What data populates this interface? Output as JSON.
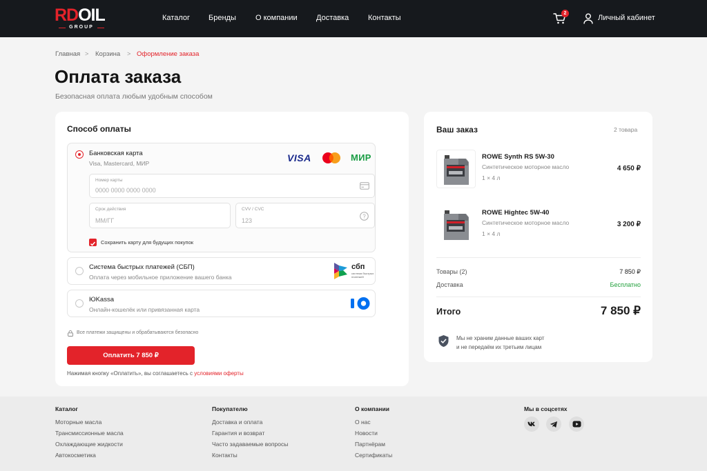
{
  "header": {
    "logo_rd": "RD",
    "logo_oil": "OIL",
    "logo_sub": "GROUP",
    "nav": [
      "Каталог",
      "Бренды",
      "О компании",
      "Доставка",
      "Контакты"
    ],
    "cart_count": "2",
    "account_label": "Личный кабинет"
  },
  "breadcrumb": {
    "items": [
      "Главная",
      "Корзина",
      "Оформление заказа"
    ],
    "separator": ">"
  },
  "page": {
    "title": "Оплата заказа",
    "subtitle": "Безопасная оплата любым удобным способом"
  },
  "payment": {
    "heading": "Способ оплаты",
    "options": [
      {
        "title": "Банковская карта",
        "desc": "Visa, Mastercard, МИР",
        "selected": true
      },
      {
        "title": "Система быстрых платежей (СБП)",
        "desc": "Оплата через мобильное приложение вашего банка",
        "selected": false
      },
      {
        "title": "ЮKassa",
        "desc": "Онлайн-кошелёк или привязанная карта",
        "selected": false
      }
    ],
    "brands": {
      "visa": "VISA",
      "mir": "МИР"
    },
    "sbp": {
      "name": "сбп",
      "tagline": "система быстрых платежей"
    },
    "fields": {
      "card_label": "Номер карты",
      "card_placeholder": "0000 0000 0000 0000",
      "expiry_label": "Срок действия",
      "expiry_placeholder": "ММ/ГГ",
      "cvv_label": "CVV / CVC",
      "cvv_placeholder": "123"
    },
    "save_card": {
      "label": "Сохранить карту для будущих покупок",
      "checked": true
    },
    "secure_note": "Все платежи защищены и обрабатываются безопасно",
    "pay_button": "Оплатить 7 850 ₽",
    "terms_prefix": "Нажимая кнопку «Оплатить», вы соглашаетесь с",
    "terms_link": "условиями оферты"
  },
  "order": {
    "heading": "Ваш заказ",
    "count": "2 товара",
    "items": [
      {
        "name": "ROWE Synth RS 5W-30",
        "desc": "Синтетическое моторное масло",
        "qty": "1 × 4 л",
        "price": "4 650 ₽"
      },
      {
        "name": "ROWE Hightec 5W-40",
        "desc": "Синтетическое моторное масло",
        "qty": "1 × 4 л",
        "price": "3 200 ₽"
      }
    ],
    "goods_label": "Товары (2)",
    "goods_value": "7 850 ₽",
    "delivery_label": "Доставка",
    "delivery_value": "Бесплатно",
    "total_label": "Итого",
    "total_value": "7 850 ₽",
    "privacy_line1": "Мы не храним данные ваших карт",
    "privacy_line2": "и не передаём их третьим лицам"
  },
  "footer": {
    "columns": [
      {
        "heading": "Каталог",
        "links": [
          "Моторные масла",
          "Трансмиссионные масла",
          "Охлаждающие жидкости",
          "Автокосметика"
        ]
      },
      {
        "heading": "Покупателю",
        "links": [
          "Доставка и оплата",
          "Гарантия и возврат",
          "Часто задаваемые вопросы",
          "Контакты"
        ]
      },
      {
        "heading": "О компании",
        "links": [
          "О нас",
          "Новости",
          "Партнёрам",
          "Сертификаты"
        ]
      }
    ],
    "social_heading": "Мы в соцсетях",
    "social_icons": [
      "vk-icon",
      "telegram-icon",
      "youtube-icon"
    ]
  },
  "colors": {
    "accent": "#e3232a",
    "header_bg": "#16191d",
    "success": "#22a03c"
  }
}
